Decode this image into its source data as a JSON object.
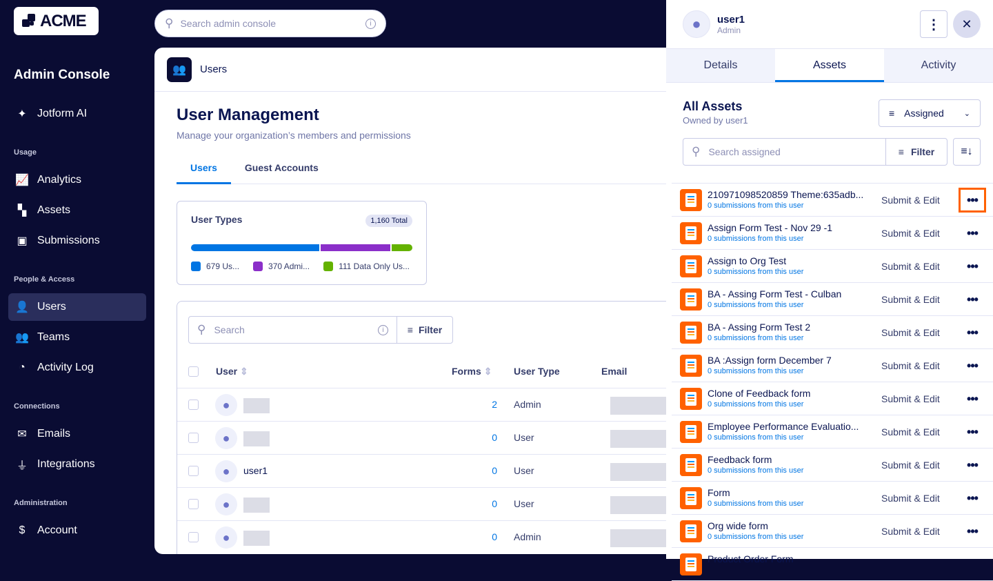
{
  "brand": {
    "logo_text": "ACME",
    "console_title": "Admin Console"
  },
  "top_search": {
    "placeholder": "Search admin console"
  },
  "sidebar": {
    "items": [
      {
        "label": "Jotform AI",
        "icon": "sparkle-icon"
      },
      {
        "section": "Usage"
      },
      {
        "label": "Analytics",
        "icon": "chart-icon"
      },
      {
        "label": "Assets",
        "icon": "assets-icon"
      },
      {
        "label": "Submissions",
        "icon": "submissions-icon"
      },
      {
        "section": "People & Access"
      },
      {
        "label": "Users",
        "icon": "users-icon",
        "active": true
      },
      {
        "label": "Teams",
        "icon": "teams-icon"
      },
      {
        "label": "Activity Log",
        "icon": "history-icon"
      },
      {
        "section": "Connections"
      },
      {
        "label": "Emails",
        "icon": "mail-icon"
      },
      {
        "label": "Integrations",
        "icon": "plug-icon"
      },
      {
        "section": "Administration"
      },
      {
        "label": "Account",
        "icon": "account-icon"
      }
    ]
  },
  "main": {
    "header": "Users",
    "title": "User Management",
    "subtitle": "Manage your organization’s members and permissions",
    "tabs": [
      "Users",
      "Guest Accounts"
    ],
    "user_types": {
      "title": "User Types",
      "total": "1,160 Total",
      "segments": [
        {
          "label": "679 Us...",
          "value": 679,
          "color": "#0075e3"
        },
        {
          "label": "370 Admi...",
          "value": 370,
          "color": "#8b2fc9"
        },
        {
          "label": "111 Data Only Us...",
          "value": 111,
          "color": "#64b200"
        }
      ]
    },
    "table": {
      "search_placeholder": "Search",
      "filter_label": "Filter",
      "columns": [
        "User",
        "Forms",
        "User Type",
        "Email"
      ],
      "rows": [
        {
          "name": "",
          "forms": "2",
          "type": "Admin"
        },
        {
          "name": "",
          "forms": "0",
          "type": "User"
        },
        {
          "name": "user1",
          "forms": "0",
          "type": "User"
        },
        {
          "name": "",
          "forms": "0",
          "type": "User"
        },
        {
          "name": "",
          "forms": "0",
          "type": "Admin"
        }
      ]
    }
  },
  "drawer": {
    "user_name": "user1",
    "user_role": "Admin",
    "tabs": [
      "Details",
      "Assets",
      "Activity"
    ],
    "section_title": "All Assets",
    "owned_by": "Owned by user1",
    "assigned_select": "Assigned",
    "search_placeholder": "Search assigned",
    "filter_label": "Filter",
    "assets": [
      {
        "name": "210971098520859 Theme:635adb...",
        "sub": "0 submissions from this user",
        "perm": "Submit & Edit"
      },
      {
        "name": "Assign Form Test - Nov 29 -1",
        "sub": "0 submissions from this user",
        "perm": "Submit & Edit"
      },
      {
        "name": "Assign to Org Test",
        "sub": "0 submissions from this user",
        "perm": "Submit & Edit"
      },
      {
        "name": "BA - Assing Form Test - Culban",
        "sub": "0 submissions from this user",
        "perm": "Submit & Edit"
      },
      {
        "name": "BA - Assing Form Test 2",
        "sub": "0 submissions from this user",
        "perm": "Submit & Edit"
      },
      {
        "name": "BA :Assign form December 7",
        "sub": "0 submissions from this user",
        "perm": "Submit & Edit"
      },
      {
        "name": "Clone of Feedback form",
        "sub": "0 submissions from this user",
        "perm": "Submit & Edit"
      },
      {
        "name": "Employee Performance Evaluatio...",
        "sub": "0 submissions from this user",
        "perm": "Submit & Edit"
      },
      {
        "name": "Feedback form",
        "sub": "0 submissions from this user",
        "perm": "Submit & Edit"
      },
      {
        "name": "Form",
        "sub": "0 submissions from this user",
        "perm": "Submit & Edit"
      },
      {
        "name": "Org wide form",
        "sub": "0 submissions from this user",
        "perm": "Submit & Edit"
      },
      {
        "name": "Product Order Form",
        "sub": "",
        "perm": ""
      }
    ]
  }
}
